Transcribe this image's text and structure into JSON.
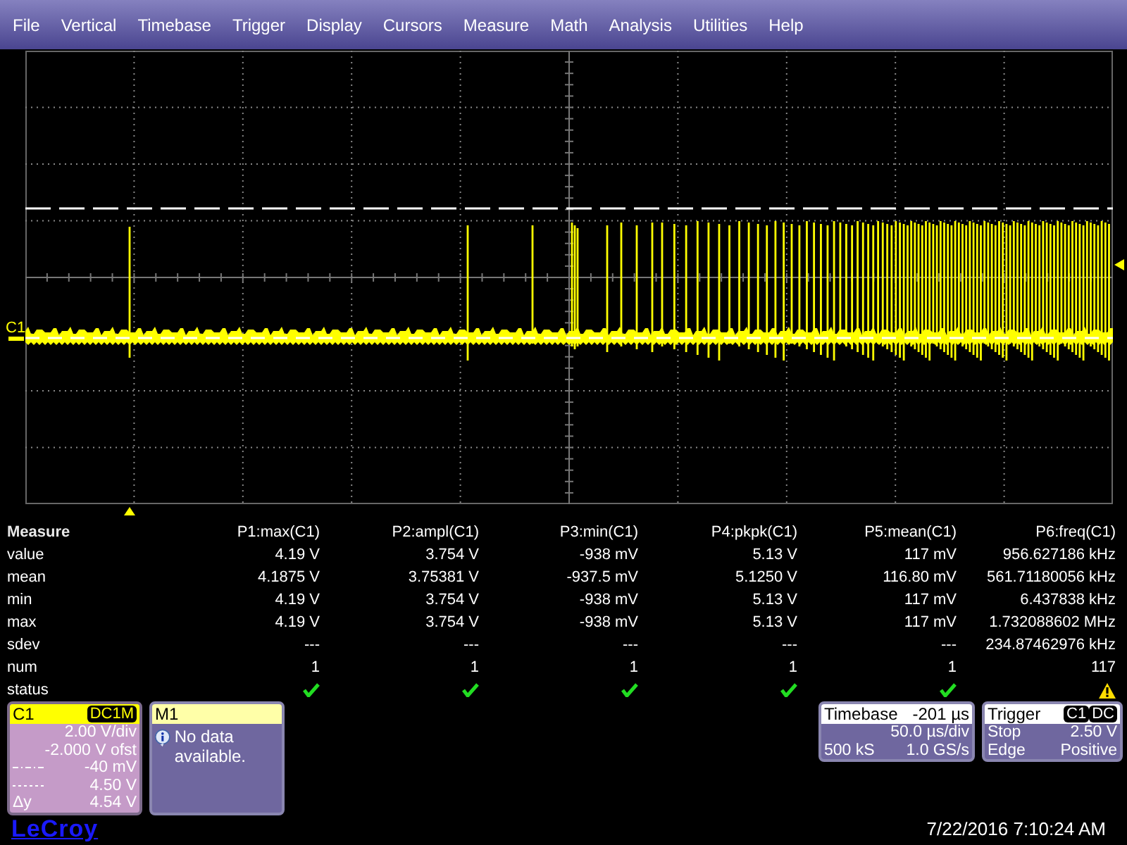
{
  "menu": [
    "File",
    "Vertical",
    "Timebase",
    "Trigger",
    "Display",
    "Cursors",
    "Measure",
    "Math",
    "Analysis",
    "Utilities",
    "Help"
  ],
  "scope": {
    "channel_label": "C1"
  },
  "measure": {
    "title": "Measure",
    "columns": [
      "P1:max(C1)",
      "P2:ampl(C1)",
      "P3:min(C1)",
      "P4:pkpk(C1)",
      "P5:mean(C1)",
      "P6:freq(C1)"
    ],
    "rows": [
      {
        "label": "value",
        "values": [
          "4.19 V",
          "3.754 V",
          "-938 mV",
          "5.13 V",
          "117 mV",
          "956.627186 kHz"
        ]
      },
      {
        "label": "mean",
        "values": [
          "4.1875 V",
          "3.75381 V",
          "-937.5 mV",
          "5.1250 V",
          "116.80 mV",
          "561.71180056 kHz"
        ]
      },
      {
        "label": "min",
        "values": [
          "4.19 V",
          "3.754 V",
          "-938 mV",
          "5.13 V",
          "117 mV",
          "6.437838 kHz"
        ]
      },
      {
        "label": "max",
        "values": [
          "4.19 V",
          "3.754 V",
          "-938 mV",
          "5.13 V",
          "117 mV",
          "1.732088602 MHz"
        ]
      },
      {
        "label": "sdev",
        "values": [
          "---",
          "---",
          "---",
          "---",
          "---",
          "234.87462976 kHz"
        ]
      },
      {
        "label": "num",
        "values": [
          "1",
          "1",
          "1",
          "1",
          "1",
          "117"
        ]
      }
    ],
    "status": {
      "label": "status",
      "cells": [
        {
          "kind": "check"
        },
        {
          "kind": "check"
        },
        {
          "kind": "check"
        },
        {
          "kind": "check"
        },
        {
          "kind": "check"
        },
        {
          "kind": "warning"
        }
      ]
    }
  },
  "channel_panel": {
    "title": "C1",
    "coupling": "DC1M",
    "rows": [
      {
        "value": "2.00 V/div"
      },
      {
        "value": "-2.000 V ofst"
      },
      {
        "kind": "dashdot",
        "value": "-40 mV"
      },
      {
        "kind": "dotted",
        "value": "4.50 V"
      },
      {
        "label": "Δy",
        "value": "4.54 V"
      }
    ]
  },
  "math_panel": {
    "title": "M1",
    "message": "No data available."
  },
  "timebase_panel": {
    "title": "Timebase",
    "delay": "-201 µs",
    "scale": "50.0 µs/div",
    "samples": "500 kS",
    "rate": "1.0 GS/s"
  },
  "trigger_panel": {
    "title": "Trigger",
    "badges": [
      "C1",
      "DC"
    ],
    "rows": [
      {
        "label": "Stop",
        "value": "2.50 V"
      },
      {
        "label": "Edge",
        "value": "Positive"
      }
    ]
  },
  "logo": "LeCroy",
  "timestamp": "7/22/2016 7:10:24 AM"
}
